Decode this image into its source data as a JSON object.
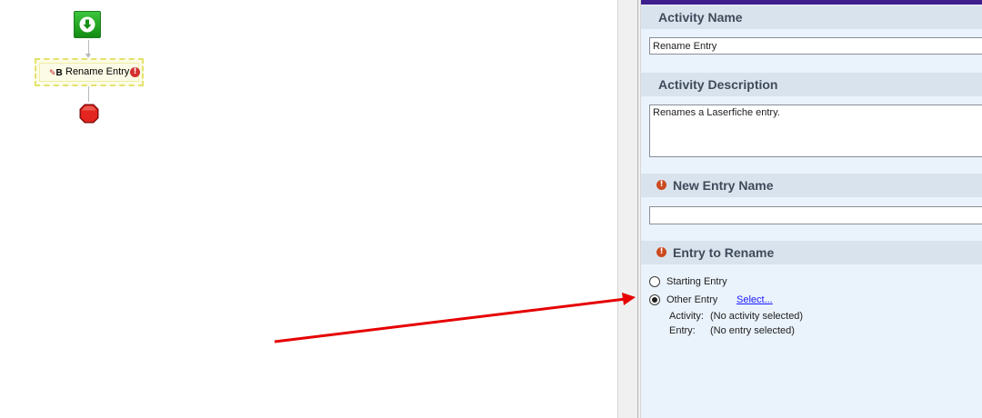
{
  "canvas": {
    "activity": {
      "label": "Rename Entry",
      "icon": "rename-entry-icon",
      "warning_icon": "error-indicator-icon",
      "warning_glyph": "!"
    }
  },
  "properties": {
    "activity_name": {
      "header": "Activity Name",
      "value": "Rename Entry"
    },
    "activity_description": {
      "header": "Activity Description",
      "value": "Renames a Laserfiche entry."
    },
    "new_entry_name": {
      "header": "New Entry Name",
      "value": "",
      "required_glyph": "!"
    },
    "entry_to_rename": {
      "header": "Entry to Rename",
      "required_glyph": "!",
      "options": [
        {
          "label": "Starting Entry",
          "selected": false
        },
        {
          "label": "Other Entry",
          "selected": true
        }
      ],
      "select_link": "Select...",
      "activity_label": "Activity:",
      "activity_value": "(No activity selected)",
      "entry_label": "Entry:",
      "entry_value": "(No entry selected)"
    }
  },
  "colors": {
    "pane_background": "#eaf2fb",
    "section_header": "#d9e3ee",
    "top_bar": "#3e1e8c",
    "required_icon": "#cc4a1f",
    "annotation_arrow": "#e60000",
    "link": "#1a1aff"
  }
}
